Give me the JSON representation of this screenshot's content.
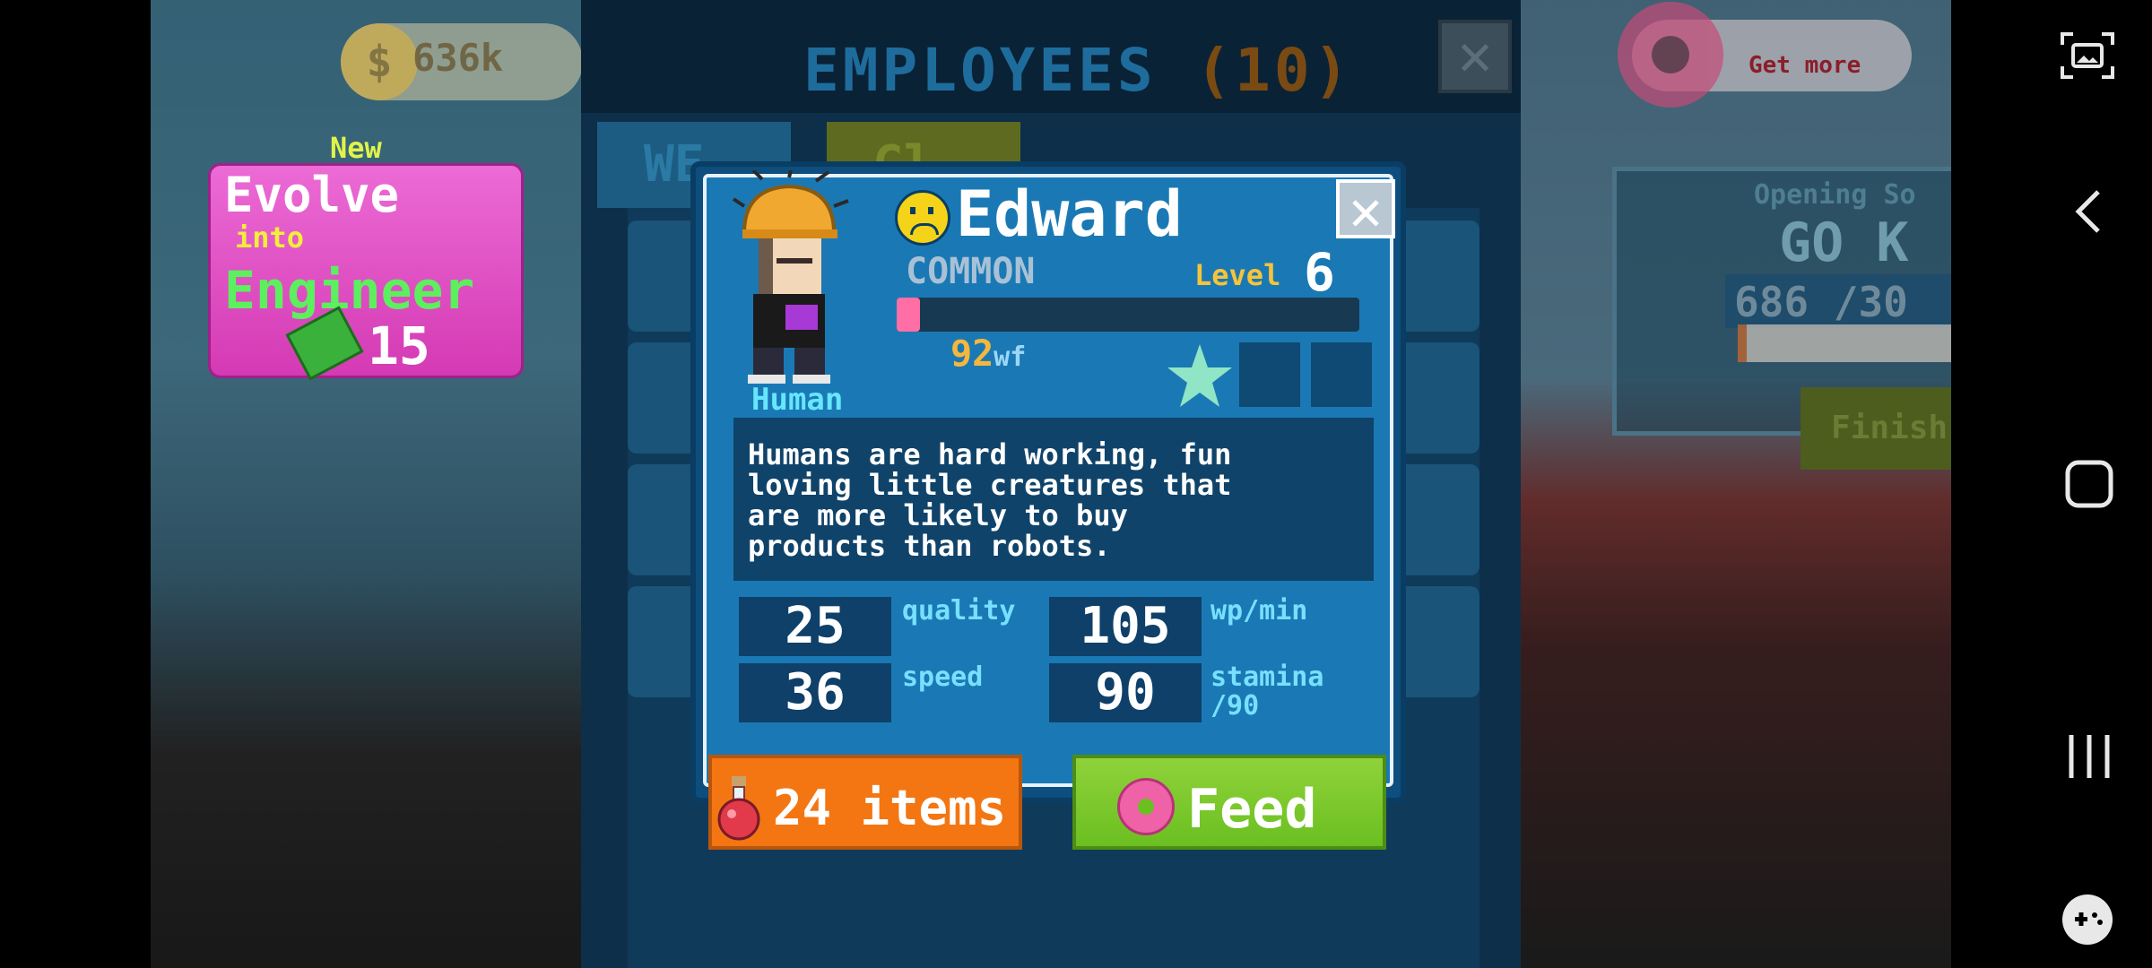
{
  "hud": {
    "coins": "636k",
    "get_more_label": "Get more"
  },
  "employees_panel": {
    "title": "EMPLOYEES",
    "count": "(10)",
    "tab_1": "WE",
    "tab_2": "Gl",
    "close_glyph": "✕"
  },
  "opening_soon": {
    "title": "Opening So",
    "headline": "GO K",
    "progress": "686 /30",
    "finish_label": "Finish"
  },
  "evolve": {
    "badge": "New",
    "line1": "Evolve",
    "line2": "into",
    "line3": "Engineer",
    "cost": "15",
    "cost_icon": "cash-icon"
  },
  "employee": {
    "name": "Edward",
    "mood_icon": "sad-face-icon",
    "rarity": "COMMON",
    "level_label": "Level",
    "level": "6",
    "xp_fraction": 0.03,
    "wf_value": "92",
    "wf_unit": "wf",
    "stars_filled": 1,
    "stars_total": 3,
    "species": "Human",
    "description": "Humans are hard working, fun\nloving little creatures that\nare more likely to buy\nproducts than robots.",
    "stats": {
      "quality_value": "25",
      "quality_label": "quality",
      "wpmin_value": "105",
      "wpmin_label": "wp/min",
      "speed_value": "36",
      "speed_label": "speed",
      "stamina_value": "90",
      "stamina_label": "stamina\n/90"
    },
    "close_glyph": "✕"
  },
  "actions": {
    "items_label": "24 items",
    "feed_label": "Feed"
  },
  "colors": {
    "dialog_bg": "#1a79b4",
    "items_button": "#f37613",
    "feed_button": "#6bbf21",
    "evolve_card": "#d43ab4"
  }
}
